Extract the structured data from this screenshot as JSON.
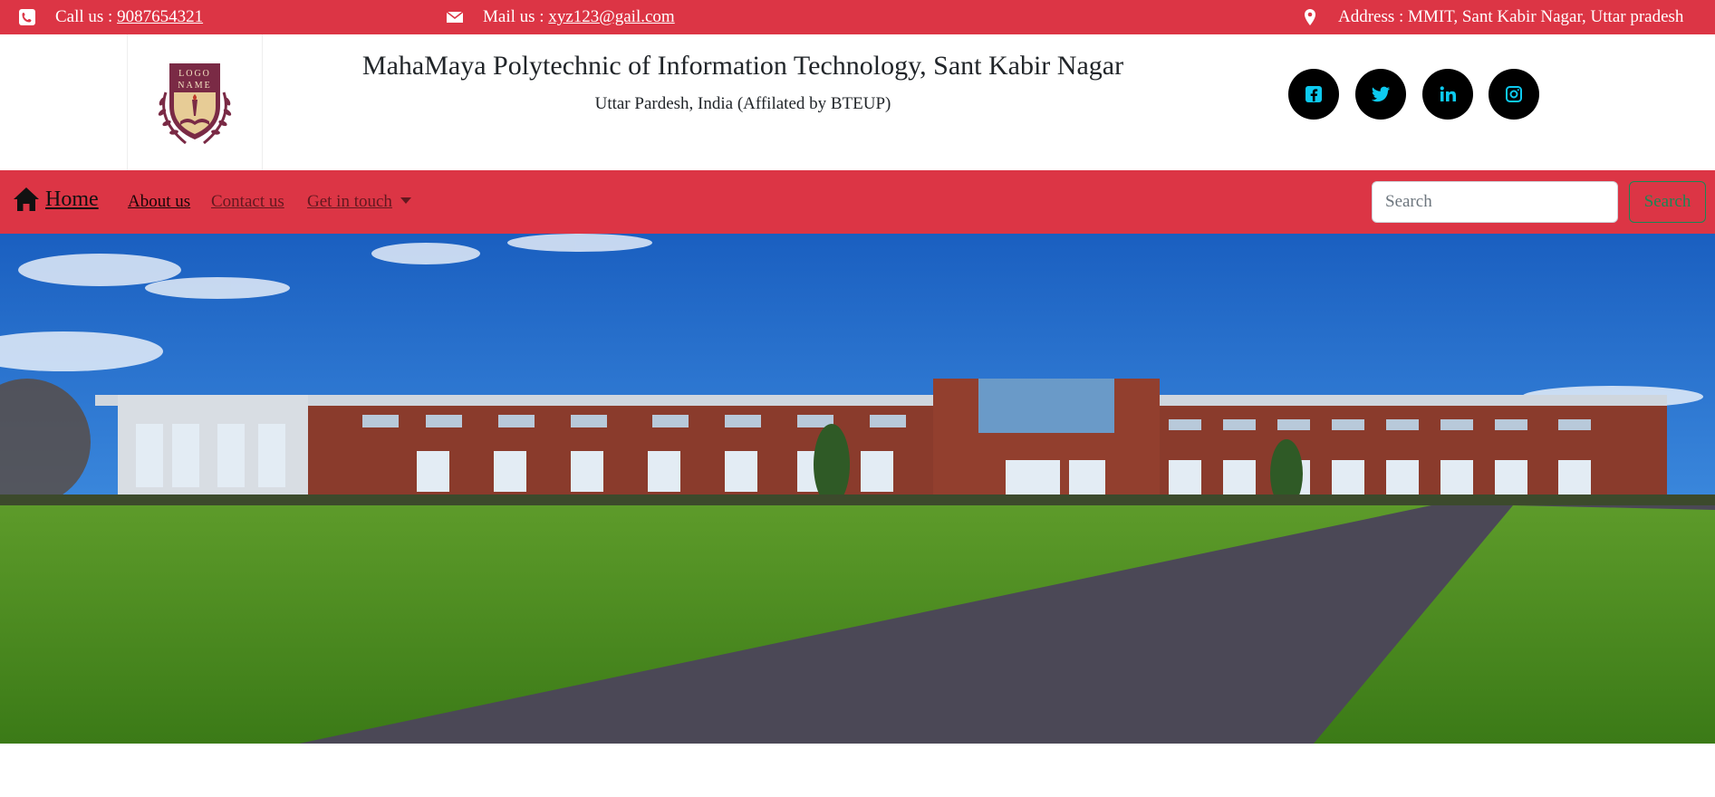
{
  "topbar": {
    "phone_label": "Call us : ",
    "phone_number": "9087654321",
    "mail_label": "Mail us : ",
    "mail_address": "xyz123@gail.com",
    "address": "Address : MMIT, Sant Kabir Nagar, Uttar pradesh",
    "icons": [
      "phone-icon",
      "envelope-icon",
      "map-pin-icon"
    ]
  },
  "header": {
    "logo_line1": "LOGO",
    "logo_line2": "NAME",
    "title": "MahaMaya Polytechnic of Information Technology, Sant Kabir Nagar",
    "subtitle": "Uttar Pardesh, India (Affilated by BTEUP)",
    "social": [
      "facebook-icon",
      "twitter-icon",
      "linkedin-icon",
      "instagram-icon"
    ]
  },
  "navbar": {
    "brand": "Home",
    "links": [
      "About us",
      "Contact us",
      "Get in touch"
    ],
    "search_placeholder": "Search",
    "search_button": "Search"
  },
  "colors": {
    "primary_red": "#dc3545",
    "social_icon": "#0dcaf0",
    "search_button": "#198754"
  }
}
